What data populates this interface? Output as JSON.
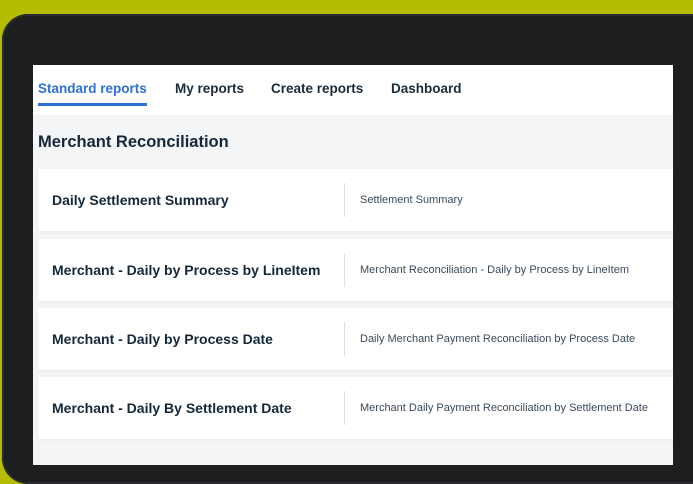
{
  "nav": {
    "tabs": [
      {
        "label": "Standard reports",
        "active": true
      },
      {
        "label": "My reports",
        "active": false
      },
      {
        "label": "Create reports",
        "active": false
      },
      {
        "label": "Dashboard",
        "active": false
      }
    ]
  },
  "section": {
    "title": "Merchant Reconciliation"
  },
  "reports": [
    {
      "name": "Daily Settlement Summary",
      "description": "Settlement Summary"
    },
    {
      "name": "Merchant - Daily by Process by LineItem",
      "description": "Merchant Reconciliation - Daily by Process by LineItem"
    },
    {
      "name": "Merchant - Daily by Process Date",
      "description": "Daily Merchant Payment Reconciliation by Process Date"
    },
    {
      "name": "Merchant - Daily By Settlement Date",
      "description": "Merchant Daily Payment Reconciliation by Settlement Date"
    }
  ],
  "colors": {
    "background": "#b5bd00",
    "accent": "#2e6fd8",
    "text": "#15283a"
  }
}
